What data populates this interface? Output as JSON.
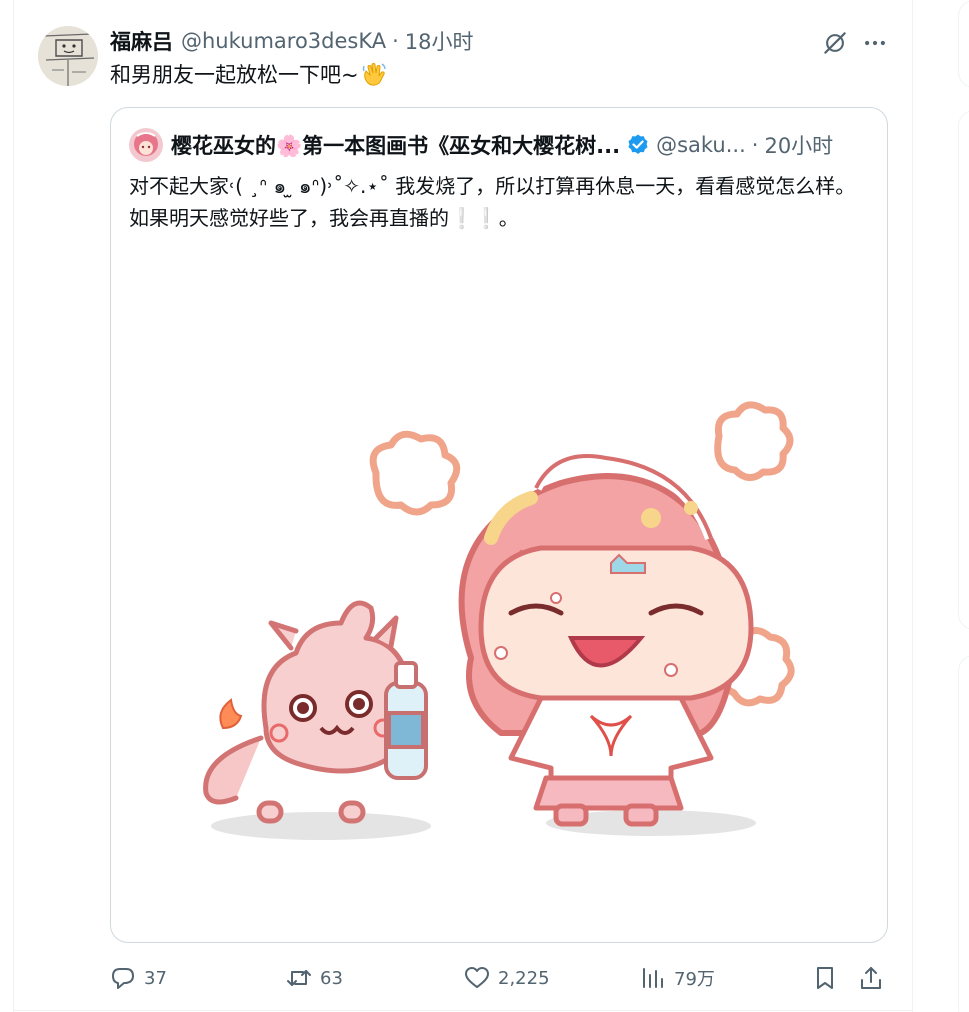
{
  "tweet": {
    "author_name": "福麻吕",
    "author_handle": "@hukumaro3desKA",
    "separator": "·",
    "time": "18小时",
    "text": "和男朋友一起放松一下吧~",
    "text_emoji": "waving-hand-emoji"
  },
  "quote": {
    "author_name": "樱花巫女的🌸第一本图画书《巫女和大樱花树...",
    "author_handle": "@saku...",
    "separator": "·",
    "time": "20小时",
    "verified": true,
    "text": "对不起大家˓( ¸ᐢ ๑ ̫ ๑ᐢ)˒˚✧.⋆˚ 我发烧了，所以打算再休息一天，看看感觉怎么样。如果明天感觉好些了，我会再直播的❕❕。"
  },
  "actions": {
    "replies": "37",
    "retweets": "63",
    "likes": "2,225",
    "views": "79万"
  },
  "icons": {
    "grok": "grok-icon",
    "more": "more-icon",
    "reply": "reply-icon",
    "retweet": "retweet-icon",
    "like": "heart-icon",
    "views": "views-chart-icon",
    "bookmark": "bookmark-icon",
    "share": "share-icon"
  },
  "colors": {
    "text_primary": "#0f1419",
    "text_secondary": "#536471",
    "verified": "#1d9bf0",
    "border": "#cfd9de"
  }
}
